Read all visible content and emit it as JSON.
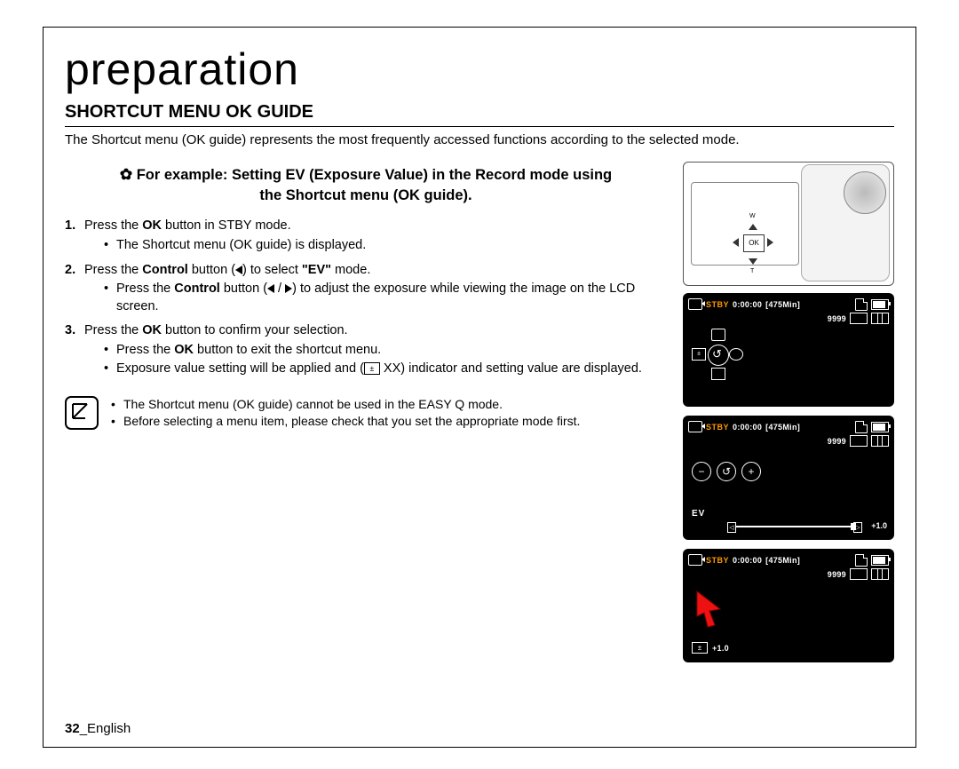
{
  "title": "preparation",
  "subtitle": "SHORTCUT MENU OK GUIDE",
  "intro": "The Shortcut menu (OK guide) represents the most frequently accessed functions according to the selected mode.",
  "example_heading_prefix": "For example: Setting EV (Exposure Value) in the Record mode using",
  "example_heading_line2": "the Shortcut menu (OK guide).",
  "steps": {
    "s1": {
      "num": "1.",
      "text_pre": "Press the ",
      "bold1": "OK",
      "text_post": " button in STBY mode.",
      "b1": "The Shortcut menu (OK guide) is displayed."
    },
    "s2": {
      "num": "2.",
      "text_pre": "Press the ",
      "bold1": "Control",
      "text_mid": " button (",
      "text_mid2": ") to select ",
      "bold2": "\"EV\"",
      "text_post": " mode.",
      "b1_pre": "Press the ",
      "b1_bold": "Control",
      "b1_mid": " button (",
      "b1_mid2": " / ",
      "b1_post": ") to adjust the exposure while viewing the image on the LCD screen."
    },
    "s3": {
      "num": "3.",
      "text_pre": "Press the ",
      "bold1": "OK",
      "text_post": " button to confirm your selection.",
      "b1_pre": "Press the ",
      "b1_bold": "OK",
      "b1_post": " button to exit the shortcut menu.",
      "b2_pre": "Exposure value setting will be applied and (",
      "b2_mid": " XX",
      "b2_post": ") indicator and setting value are displayed."
    }
  },
  "notes": {
    "n1": "The Shortcut menu (OK guide) cannot be used in the EASY Q mode.",
    "n2": "Before selecting a menu item, please check that you set the appropriate mode first."
  },
  "camera": {
    "ok": "OK",
    "w": "W",
    "t": "T"
  },
  "screens": {
    "stby": "STBY",
    "time": "0:00:00",
    "remain": "[475Min]",
    "counter": "9999",
    "ev_label": "EV",
    "ev_value": "+1.0",
    "minus": "−",
    "plus": "+",
    "slider_left": "◁",
    "slider_right": "▷",
    "pm_icon": "±"
  },
  "footer": {
    "page": "32",
    "lang": "_English"
  }
}
